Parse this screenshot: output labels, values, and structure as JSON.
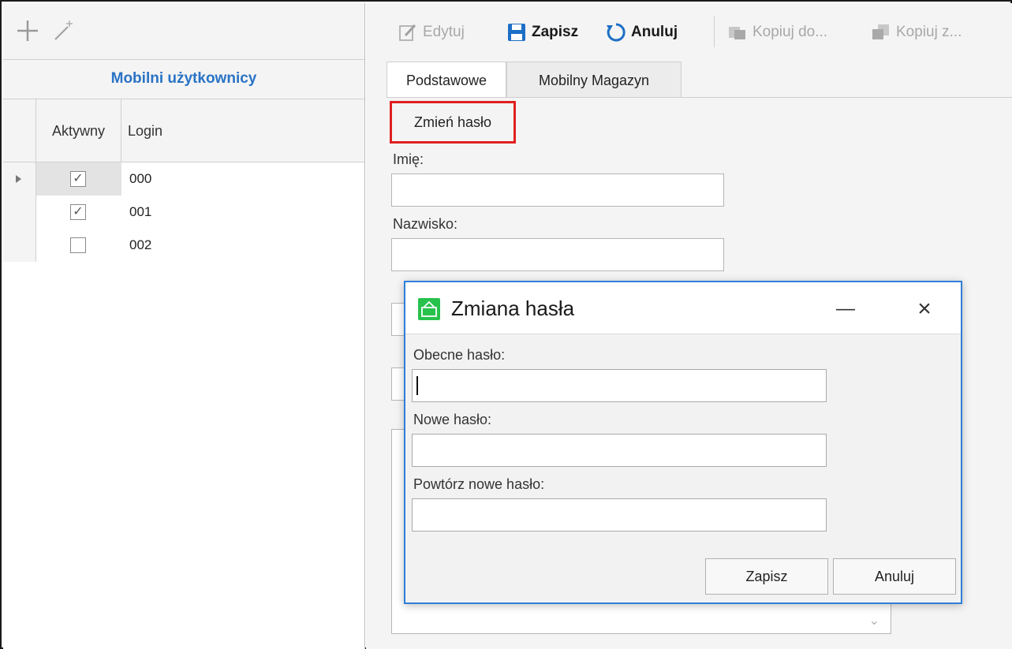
{
  "left": {
    "toolbar": {
      "add_icon": "plus-icon",
      "wizard_icon": "magic-wand-icon"
    },
    "title": "Mobilni użytkownicy",
    "grid": {
      "headers": {
        "active": "Aktywny",
        "login": "Login"
      },
      "rows": [
        {
          "active": true,
          "login": "000",
          "selected": true
        },
        {
          "active": true,
          "login": "001",
          "selected": false
        },
        {
          "active": false,
          "login": "002",
          "selected": false
        }
      ]
    }
  },
  "toolbar": {
    "edit_label": "Edytuj",
    "save_label": "Zapisz",
    "cancel_label": "Anuluj",
    "copy_to_label": "Kopiuj do...",
    "copy_from_label": "Kopiuj z..."
  },
  "tabs": [
    {
      "label": "Podstawowe",
      "active": true
    },
    {
      "label": "Mobilny Magazyn",
      "active": false
    }
  ],
  "form": {
    "change_password_label": "Zmień hasło",
    "first_name_label": "Imię:",
    "first_name_value": "",
    "last_name_label": "Nazwisko:",
    "last_name_value": ""
  },
  "dialog": {
    "title": "Zmiana hasła",
    "current_label": "Obecne hasło:",
    "current_value": "",
    "new_label": "Nowe hasło:",
    "new_value": "",
    "repeat_label": "Powtórz nowe hasło:",
    "repeat_value": "",
    "save_label": "Zapisz",
    "cancel_label": "Anuluj"
  },
  "colors": {
    "title_blue": "#2a73c5",
    "highlight_red": "#e02020",
    "dialog_border": "#2f7ed8",
    "app_icon_green": "#27c24c"
  }
}
